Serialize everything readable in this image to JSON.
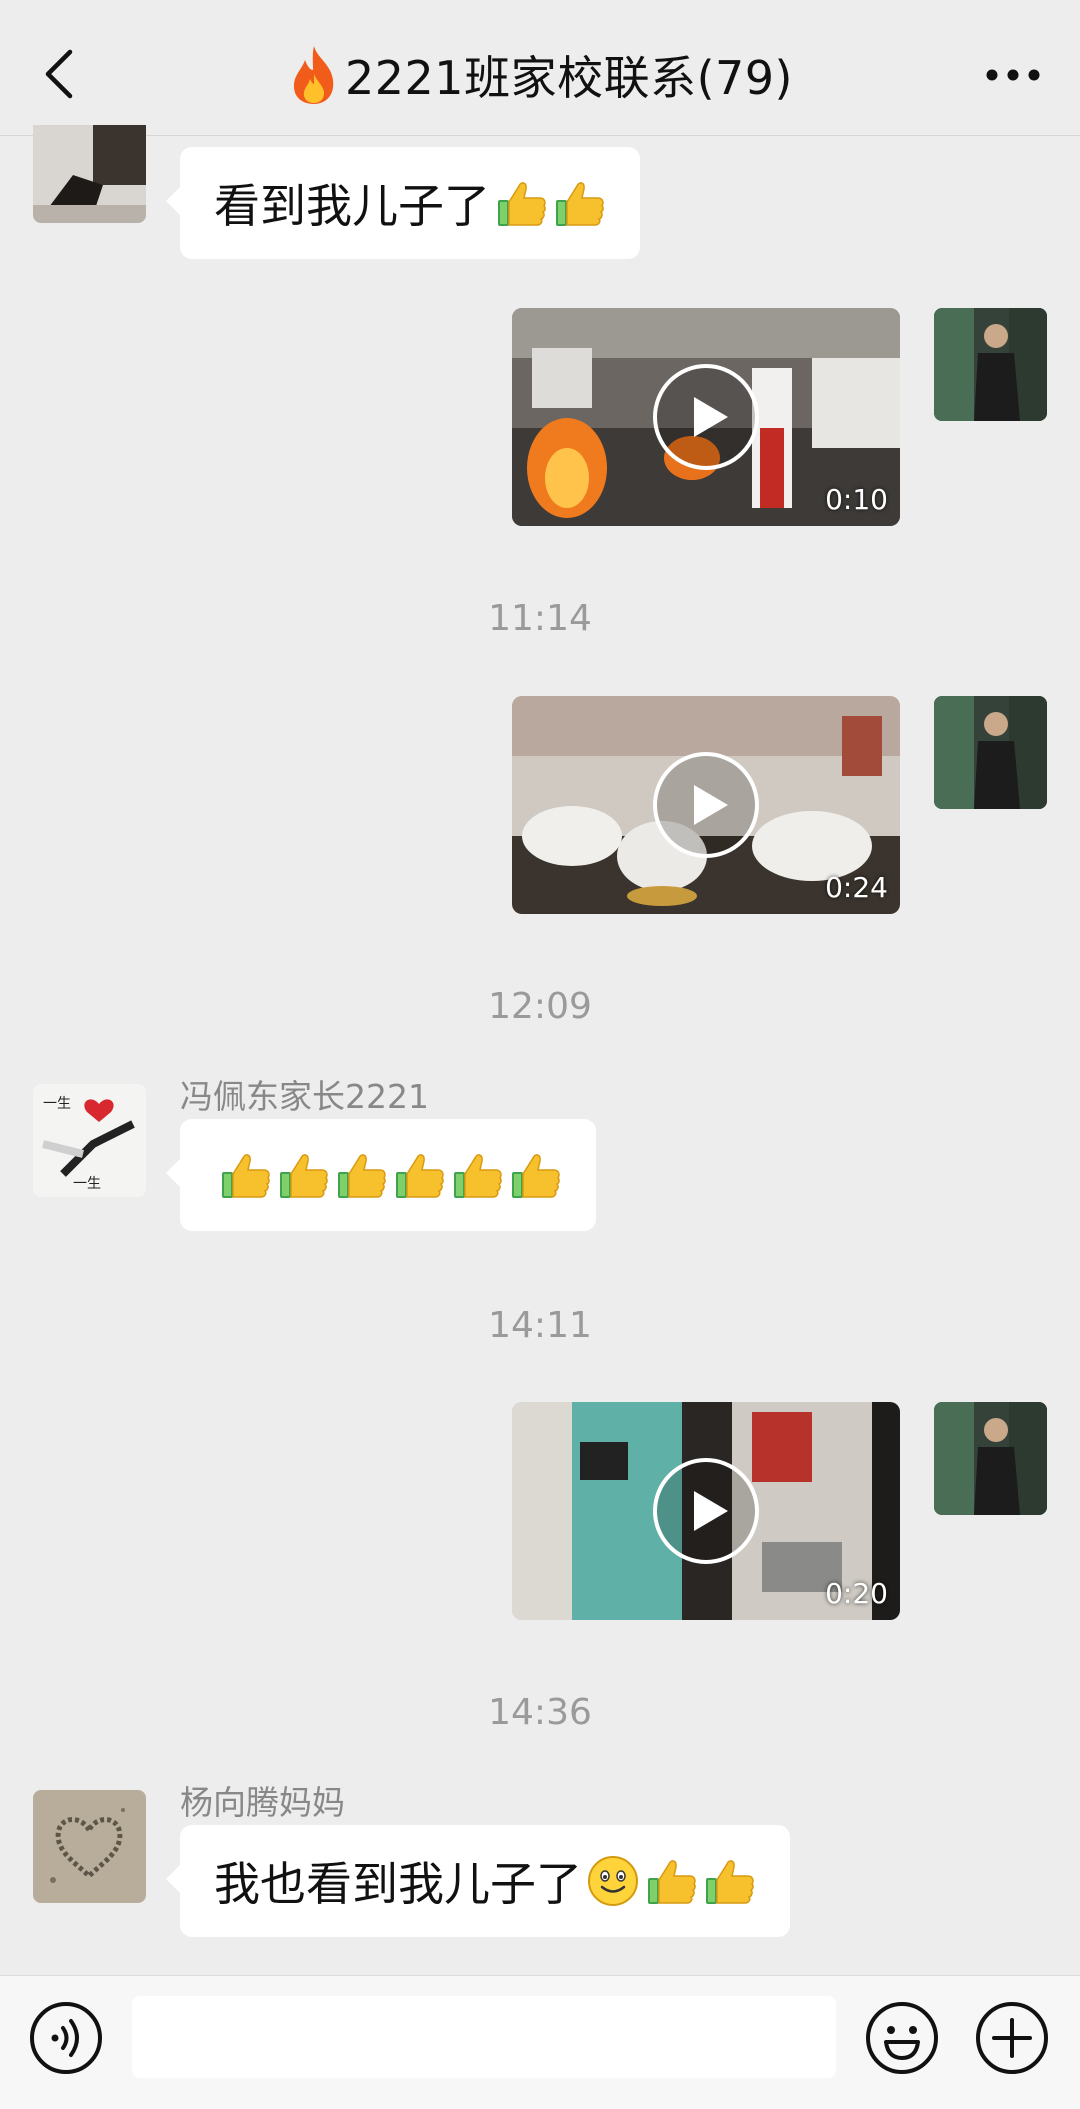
{
  "header": {
    "back_icon": "chevron-left-icon",
    "title_icon": "fire-emoji",
    "title": "2221班家校联系(79)",
    "more_icon": "more-dots-icon"
  },
  "messages": [
    {
      "type": "text",
      "side": "left",
      "text": "看到我儿子了",
      "emoji": [
        "thumbs-up",
        "thumbs-up"
      ]
    },
    {
      "type": "video",
      "side": "right",
      "duration": "0:10"
    },
    {
      "type": "time",
      "text": "11:14"
    },
    {
      "type": "video",
      "side": "right",
      "duration": "0:24"
    },
    {
      "type": "time",
      "text": "12:09"
    },
    {
      "type": "text",
      "side": "left",
      "sender": "冯佩东家长2221",
      "text": "",
      "emoji": [
        "thumbs-up",
        "thumbs-up",
        "thumbs-up",
        "thumbs-up",
        "thumbs-up",
        "thumbs-up"
      ]
    },
    {
      "type": "time",
      "text": "14:11"
    },
    {
      "type": "video",
      "side": "right",
      "duration": "0:20"
    },
    {
      "type": "time",
      "text": "14:36"
    },
    {
      "type": "text",
      "side": "left",
      "sender": "杨向腾妈妈",
      "text": "我也看到我儿子了",
      "emoji": [
        "smiley",
        "thumbs-up",
        "thumbs-up"
      ]
    }
  ],
  "input_bar": {
    "voice_icon": "voice-icon",
    "placeholder": "",
    "emoji_icon": "emoji-icon",
    "plus_icon": "plus-icon"
  },
  "colors": {
    "background": "#ededed",
    "bubble": "#ffffff",
    "timestamp": "#9a9a9a",
    "sender": "#888888"
  }
}
